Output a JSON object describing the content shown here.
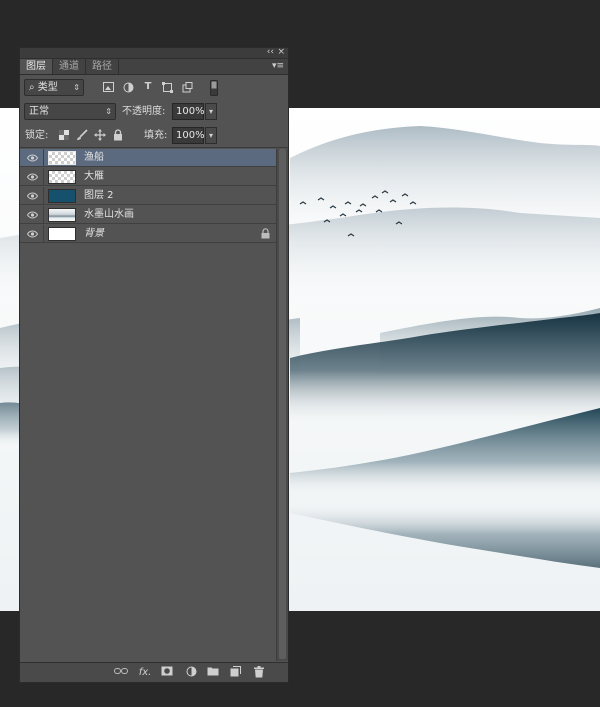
{
  "panel": {
    "topbar": {
      "collapse_glyph": "‹‹",
      "close_glyph": "×"
    },
    "tabs": [
      {
        "label": "图层",
        "active": true
      },
      {
        "label": "通道",
        "active": false
      },
      {
        "label": "路径",
        "active": false
      }
    ],
    "tab_menu_glyph": "▾≡",
    "filter": {
      "search_glyph": "⌕",
      "value": "类型"
    },
    "blend_mode": {
      "value": "正常"
    },
    "opacity": {
      "label": "不透明度:",
      "value": "100%"
    },
    "lock": {
      "label": "锁定:"
    },
    "fill": {
      "label": "填充:",
      "value": "100%"
    },
    "layers": [
      {
        "name": "渔船",
        "thumb": "checker",
        "selected": true
      },
      {
        "name": "大雁",
        "thumb": "checker",
        "selected": false
      },
      {
        "name": "图层 2",
        "thumb": "solid",
        "selected": false
      },
      {
        "name": "水墨山水画",
        "thumb": "landscape",
        "selected": false
      },
      {
        "name": "背景",
        "thumb": "white",
        "selected": false,
        "locked": true
      }
    ],
    "colors": {
      "selected_row": "#5c6a80",
      "solid_thumb": "#15506c",
      "panel_bg": "#535353"
    }
  }
}
